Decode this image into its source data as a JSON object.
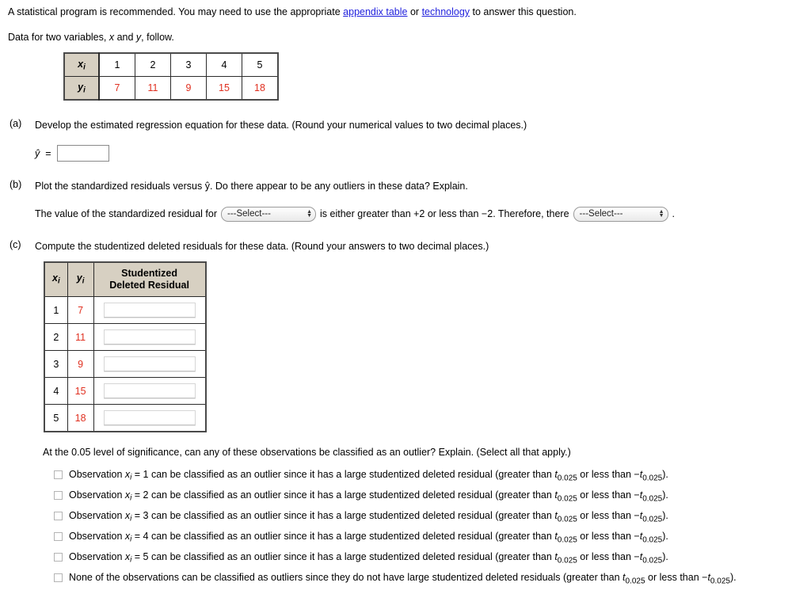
{
  "intro": {
    "line1_part1": "A statistical program is recommended. You may need to use the appropriate ",
    "link1": "appendix table",
    "line1_mid": " or ",
    "link2": "technology",
    "line1_part2": " to answer this question.",
    "data_note_pre": "Data for two variables, ",
    "data_note_x": "x",
    "data_note_and": " and ",
    "data_note_y": "y",
    "data_note_post": ", follow."
  },
  "data_table": {
    "x_header": "x",
    "y_header": "y",
    "subscript": "i",
    "x_values": [
      "1",
      "2",
      "3",
      "4",
      "5"
    ],
    "y_values": [
      "7",
      "11",
      "9",
      "15",
      "18"
    ],
    "y_color": "#e03020",
    "header_bg": "#d7d0c2"
  },
  "part_a": {
    "label": "(a)",
    "text": "Develop the estimated regression equation for these data. (Round your numerical values to two decimal places.)",
    "yhat_label": "ŷ",
    "equals": "=",
    "input_value": "",
    "input_placeholder": ""
  },
  "part_b": {
    "label": "(b)",
    "text": "Plot the standardized residuals versus ŷ. Do there appear to be any outliers in these data? Explain.",
    "sentence_1": "The value of the standardized residual for",
    "select_1_value": "---Select---",
    "sentence_2": "is either greater than +2 or less than −2. Therefore, there",
    "select_2_value": "---Select---",
    "sentence_3": "."
  },
  "part_c": {
    "label": "(c)",
    "text": "Compute the studentized deleted residuals for these data. (Round your answers to two decimal places.)",
    "table": {
      "headers": [
        "x",
        "y",
        "Studentized Deleted Residual"
      ],
      "header_line1": "Studentized",
      "header_line2": "Deleted Residual",
      "subscript": "i",
      "rows": [
        {
          "x": "1",
          "y": "7",
          "residual": ""
        },
        {
          "x": "2",
          "y": "11",
          "residual": ""
        },
        {
          "x": "3",
          "y": "9",
          "residual": ""
        },
        {
          "x": "4",
          "y": "15",
          "residual": ""
        },
        {
          "x": "5",
          "y": "18",
          "residual": ""
        }
      ]
    },
    "significance_question": "At the 0.05 level of significance, can any of these observations be classified as an outlier? Explain. (Select all that apply.)",
    "options": [
      {
        "pre": "Observation ",
        "var": "x",
        "sub": "i",
        "mid": " = 1 can be classified as an outlier since it has a large studentized deleted residual (greater than ",
        "t1": "t",
        "t1sub": "0.025",
        "mid2": " or less than −",
        "t2": "t",
        "t2sub": "0.025",
        "post": ")."
      },
      {
        "pre": "Observation ",
        "var": "x",
        "sub": "i",
        "mid": " = 2 can be classified as an outlier since it has a large studentized deleted residual (greater than ",
        "t1": "t",
        "t1sub": "0.025",
        "mid2": " or less than −",
        "t2": "t",
        "t2sub": "0.025",
        "post": ")."
      },
      {
        "pre": "Observation ",
        "var": "x",
        "sub": "i",
        "mid": " = 3 can be classified as an outlier since it has a large studentized deleted residual (greater than ",
        "t1": "t",
        "t1sub": "0.025",
        "mid2": " or less than −",
        "t2": "t",
        "t2sub": "0.025",
        "post": ")."
      },
      {
        "pre": "Observation ",
        "var": "x",
        "sub": "i",
        "mid": " = 4 can be classified as an outlier since it has a large studentized deleted residual (greater than ",
        "t1": "t",
        "t1sub": "0.025",
        "mid2": " or less than −",
        "t2": "t",
        "t2sub": "0.025",
        "post": ")."
      },
      {
        "pre": "Observation ",
        "var": "x",
        "sub": "i",
        "mid": " = 5 can be classified as an outlier since it has a large studentized deleted residual (greater than ",
        "t1": "t",
        "t1sub": "0.025",
        "mid2": " or less than −",
        "t2": "t",
        "t2sub": "0.025",
        "post": ")."
      },
      {
        "pre": "None of the observations can be classified as outliers since they do not have large studentized deleted residuals (greater than ",
        "var": "",
        "sub": "",
        "mid": "",
        "t1": "t",
        "t1sub": "0.025",
        "mid2": " or less than −",
        "t2": "t",
        "t2sub": "0.025",
        "post": ")."
      }
    ]
  }
}
